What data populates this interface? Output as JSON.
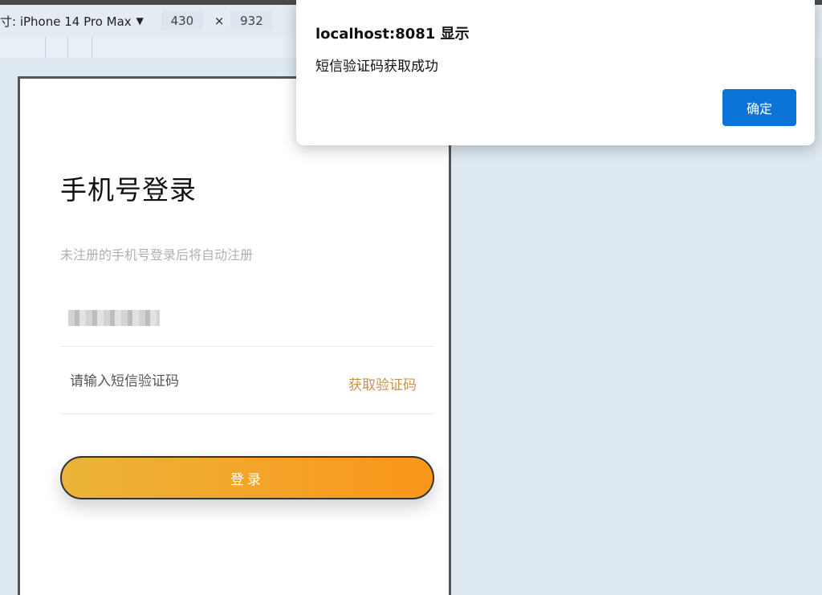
{
  "devtools": {
    "device_label": "寸: iPhone 14 Pro Max",
    "caret": "▼",
    "width": "430",
    "times": "×",
    "height": "932"
  },
  "login": {
    "title": "手机号登录",
    "subtitle": "未注册的手机号登录后将自动注册",
    "code_placeholder": "请输入短信验证码",
    "get_code": "获取验证码",
    "login_button": "登录"
  },
  "dialog": {
    "title": "localhost:8081 显示",
    "message": "短信验证码获取成功",
    "ok": "确定"
  },
  "colors": {
    "accent_gold": "#c8924f",
    "button_start": "#ecb43a",
    "button_end": "#fa961a",
    "dialog_button": "#0b74d6"
  }
}
